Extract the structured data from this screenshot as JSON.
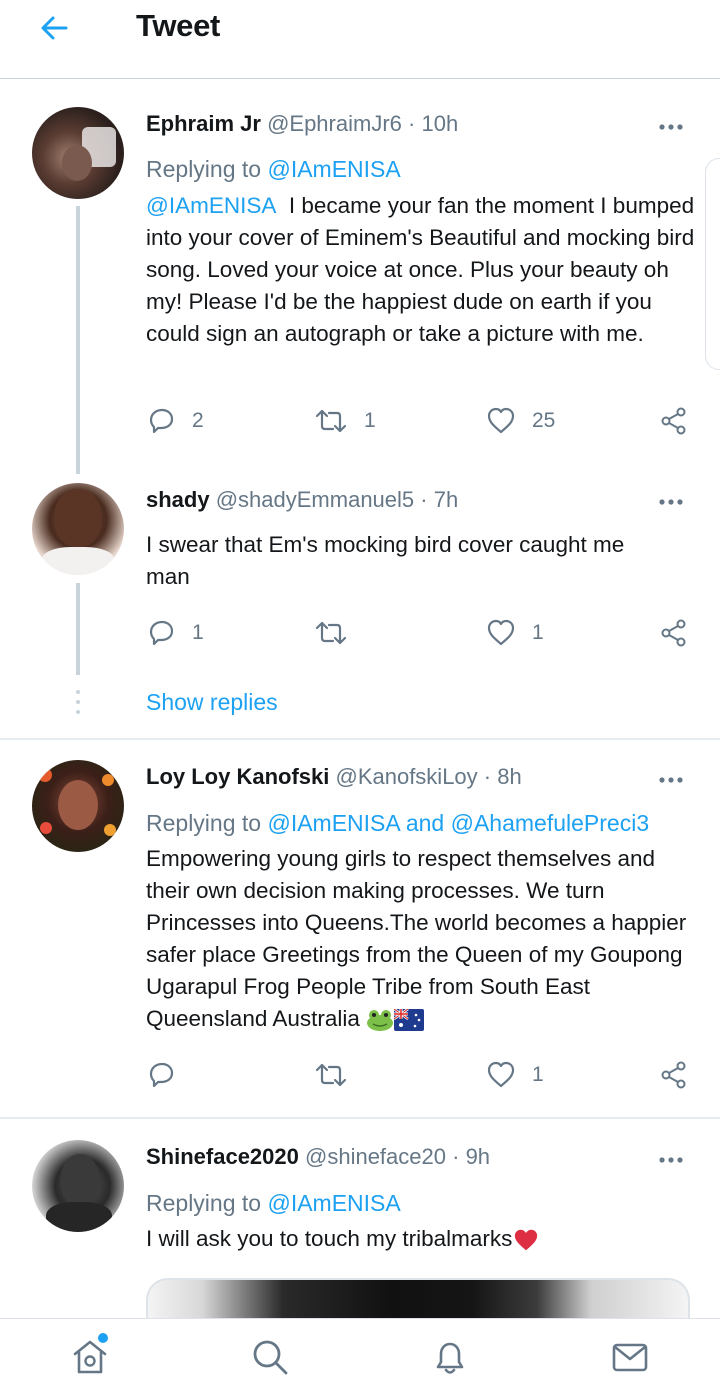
{
  "header": {
    "title": "Tweet"
  },
  "tweets": [
    {
      "name": "Ephraim Jr",
      "handle": "@EphraimJr6",
      "sep": "·",
      "time": "10h",
      "reply_prefix": "Replying to",
      "reply_to": "@IAmENISA",
      "mention": "@IAmENISA",
      "text": "I became your fan the moment I bumped into your cover of Eminem's Beautiful and mocking bird song. Loved your voice at once. Plus your beauty oh my! Please I'd be the happiest dude on earth if you could sign an autograph or take a picture with me.",
      "replies": "2",
      "retweets": "1",
      "likes": "25"
    },
    {
      "name": "shady",
      "handle": "@shadyEmmanuel5",
      "sep": "·",
      "time": "7h",
      "text": "I swear that Em's mocking bird cover caught me man",
      "replies": "1",
      "retweets": "",
      "likes": "1"
    },
    {
      "name": "Loy Loy Kanofski",
      "handle": "@KanofskiLoy",
      "sep": "·",
      "time": "8h",
      "reply_prefix": "Replying to",
      "reply_to": "@IAmENISA and @AhamefulePreci3",
      "text": "Empowering young girls to respect themselves and their own decision making processes. We turn Princesses into Queens.The world becomes a happier safer place Greetings from the Queen of my Goupong Ugarapul Frog People Tribe from South East Queensland Australia",
      "replies": "",
      "retweets": "",
      "likes": "1"
    },
    {
      "name": "Shineface2020",
      "handle": "@shineface20",
      "sep": "·",
      "time": "9h",
      "reply_prefix": "Replying to",
      "reply_to": "@IAmENISA",
      "text": "I will ask you to touch my tribalmarks"
    }
  ],
  "show_replies": "Show replies",
  "icons": [
    "back-arrow-icon",
    "more-icon",
    "reply-icon",
    "retweet-icon",
    "like-icon",
    "share-icon",
    "home-icon",
    "search-icon",
    "notifications-icon",
    "messages-icon",
    "frog-emoji",
    "australia-flag-emoji",
    "red-heart-emoji"
  ],
  "colors": {
    "accent": "#1da1f2",
    "secondary_text": "#657786",
    "divider": "#e6ecf0"
  }
}
